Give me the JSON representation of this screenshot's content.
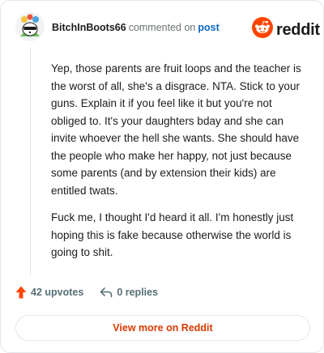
{
  "comment": {
    "username": "BitchInBoots66",
    "commented_text": "commented on",
    "post_link": "post",
    "paragraphs": [
      "Yep, those parents are fruit loops and the teacher is the worst of all, she's a disgrace. NTA. Stick to your guns. Explain it if you feel like it but you're not obliged to. It's your daughters bday and she can invite whoever the hell she wants. She should have the people who make her happy, not just because some parents (and by extension their kids) are entitled twats.",
      "Fuck me, I thought I'd heard it all. I'm honestly just hoping this is fake because otherwise the world is going to shit."
    ]
  },
  "brand": {
    "name": "reddit",
    "icon": "reddit-logo-icon",
    "color": "#ff4500"
  },
  "actions": {
    "upvotes_label": "42 upvotes",
    "upvote_icon": "upvote-arrow-icon",
    "upvote_color": "#ff4500",
    "replies_label": "0 replies",
    "reply_icon": "reply-icon"
  },
  "footer": {
    "view_more_label": "View more on Reddit",
    "accent": "#d93a00"
  }
}
